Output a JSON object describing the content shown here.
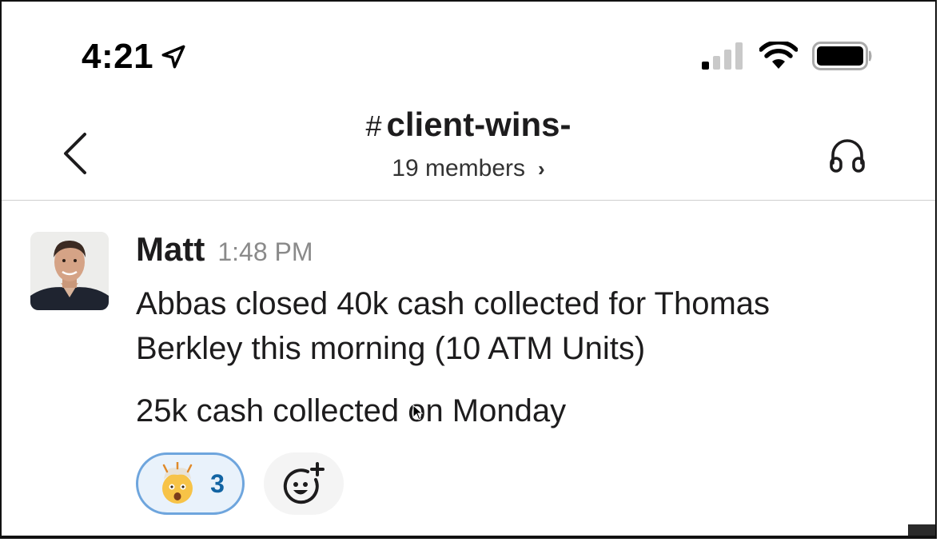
{
  "status_bar": {
    "time": "4:21",
    "icons": [
      "location-arrow-icon",
      "cellular-signal-icon",
      "wifi-icon",
      "battery-icon"
    ]
  },
  "header": {
    "channel_hash": "#",
    "channel_name": "client-wins-",
    "members": "19 members",
    "members_chevron": "›",
    "icons": [
      "back-chevron-icon",
      "headphones-icon"
    ]
  },
  "message": {
    "author": "Matt",
    "time": "1:48 PM",
    "text_line1": "Abbas closed 40k cash collected for Thomas Berkley this morning (10 ATM Units)",
    "text_line2": "25k cash collected on Monday",
    "reactions": [
      {
        "emoji": "exploding-head-emoji",
        "count": "3",
        "selected": true
      }
    ],
    "add_reaction_icon": "add-reaction-icon"
  },
  "colors": {
    "reaction_border": "#6ea5dd",
    "reaction_bg": "#e9f2fb",
    "reaction_count": "#1264a3",
    "timestamp": "#8a8a8a",
    "text": "#1d1c1d"
  }
}
